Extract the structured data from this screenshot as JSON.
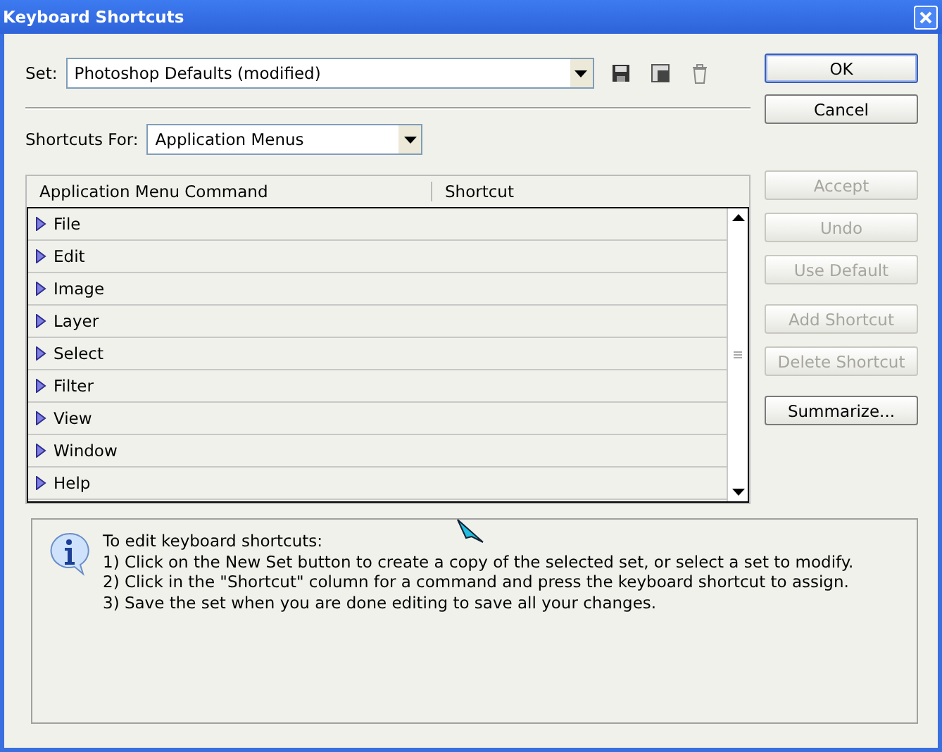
{
  "window": {
    "title": "Keyboard Shortcuts"
  },
  "set": {
    "label": "Set:",
    "value": "Photoshop Defaults (modified)"
  },
  "shortcuts_for": {
    "label": "Shortcuts For:",
    "value": "Application Menus"
  },
  "table": {
    "columns": [
      "Application Menu Command",
      "Shortcut"
    ],
    "rows": [
      {
        "label": "File",
        "expanded": false
      },
      {
        "label": "Edit",
        "expanded": false
      },
      {
        "label": "Image",
        "expanded": false
      },
      {
        "label": "Layer",
        "expanded": false
      },
      {
        "label": "Select",
        "expanded": false
      },
      {
        "label": "Filter",
        "expanded": false
      },
      {
        "label": "View",
        "expanded": false
      },
      {
        "label": "Window",
        "expanded": false
      },
      {
        "label": "Help",
        "expanded": false
      }
    ]
  },
  "buttons": [
    {
      "label": "OK",
      "disabled": false,
      "default": true
    },
    {
      "label": "Cancel",
      "disabled": false,
      "default": false
    }
  ],
  "side_buttons": [
    {
      "label": "Accept",
      "disabled": true
    },
    {
      "label": "Undo",
      "disabled": true
    },
    {
      "label": "Use Default",
      "disabled": true
    },
    {
      "label": "Add Shortcut",
      "disabled": true
    },
    {
      "label": "Delete Shortcut",
      "disabled": true
    },
    {
      "label": "Summarize...",
      "disabled": false
    }
  ],
  "info": {
    "title": "To edit keyboard shortcuts:",
    "lines": [
      "1) Click on the New Set button to create a copy of the selected set, or select a set to modify.",
      "2) Click in the \"Shortcut\" column for a command and press the keyboard shortcut to assign.",
      "3) Save the set when you are done editing to save all your changes."
    ]
  }
}
